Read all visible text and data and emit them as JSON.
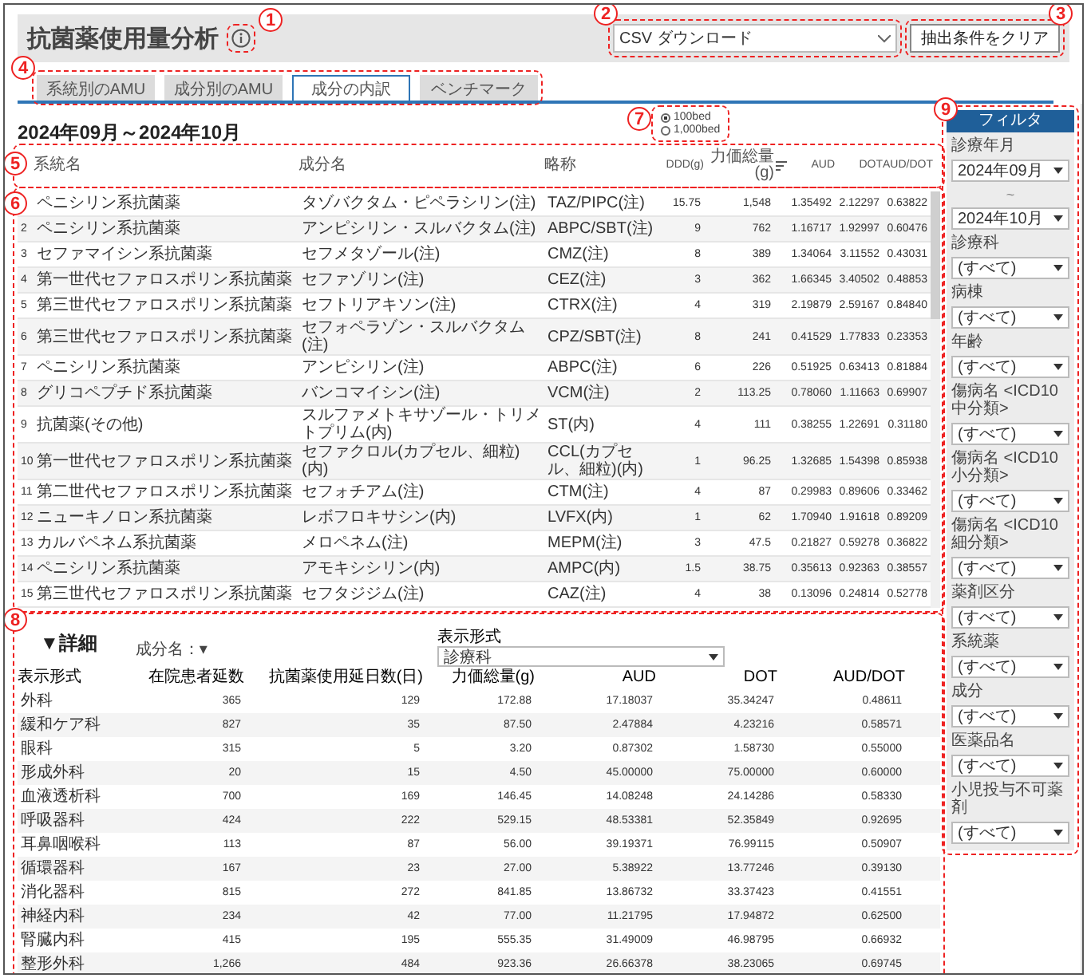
{
  "header": {
    "title": "抗菌薬使用量分析",
    "download": {
      "value": "CSV ダウンロード"
    },
    "clear_button": "抽出条件をクリア"
  },
  "tabs": [
    {
      "label": "系統別のAMU",
      "selected": false
    },
    {
      "label": "成分別のAMU",
      "selected": false
    },
    {
      "label": "成分の内訳",
      "selected": true
    },
    {
      "label": "ベンチマーク",
      "selected": false
    }
  ],
  "period": "2024年09月～2024年10月",
  "bed_options": [
    {
      "label": "100bed",
      "selected": true
    },
    {
      "label": "1,000bed",
      "selected": false
    }
  ],
  "table": {
    "columns": [
      "系統名",
      "成分名",
      "略称",
      "DDD(g)",
      "力価総量(g)",
      "AUD",
      "DOT",
      "AUD/DOT"
    ],
    "rows": [
      {
        "cells": [
          "ペニシリン系抗菌薬",
          "タゾバクタム・ピペラシリン(注)",
          "TAZ/PIPC(注)",
          "15.75",
          "1,548",
          "1.35492",
          "2.12297",
          "0.63822"
        ]
      },
      {
        "index": "2",
        "cells": [
          "ペニシリン系抗菌薬",
          "アンピシリン・スルバクタム(注)",
          "ABPC/SBT(注)",
          "9",
          "762",
          "1.16717",
          "1.92997",
          "0.60476"
        ]
      },
      {
        "index": "3",
        "cells": [
          "セファマイシン系抗菌薬",
          "セフメタゾール(注)",
          "CMZ(注)",
          "8",
          "389",
          "1.34064",
          "3.11552",
          "0.43031"
        ]
      },
      {
        "index": "4",
        "cells": [
          "第一世代セファロスポリン系抗菌薬",
          "セファゾリン(注)",
          "CEZ(注)",
          "3",
          "362",
          "1.66345",
          "3.40502",
          "0.48853"
        ]
      },
      {
        "index": "5",
        "cells": [
          "第三世代セファロスポリン系抗菌薬",
          "セフトリアキソン(注)",
          "CTRX(注)",
          "4",
          "319",
          "2.19879",
          "2.59167",
          "0.84840"
        ]
      },
      {
        "index": "6",
        "cells": [
          "第三世代セファロスポリン系抗菌薬",
          "セフォペラゾン・スルバクタム(注)",
          "CPZ/SBT(注)",
          "8",
          "241",
          "0.41529",
          "1.77833",
          "0.23353"
        ]
      },
      {
        "index": "7",
        "cells": [
          "ペニシリン系抗菌薬",
          "アンピシリン(注)",
          "ABPC(注)",
          "6",
          "226",
          "0.51925",
          "0.63413",
          "0.81884"
        ]
      },
      {
        "index": "8",
        "cells": [
          "グリコペプチド系抗菌薬",
          "バンコマイシン(注)",
          "VCM(注)",
          "2",
          "113.25",
          "0.78060",
          "1.11663",
          "0.69907"
        ]
      },
      {
        "index": "9",
        "cells": [
          "抗菌薬(その他)",
          "スルファメトキサゾール・トリメトプリム(内)",
          "ST(内)",
          "4",
          "111",
          "0.38255",
          "1.22691",
          "0.31180"
        ]
      },
      {
        "index": "10",
        "cells": [
          "第一世代セファロスポリン系抗菌薬",
          "セファクロル(カプセル、細粒)(内)",
          "CCL(カプセル、細粒)(内)",
          "1",
          "96.25",
          "1.32685",
          "1.54398",
          "0.85938"
        ]
      },
      {
        "index": "11",
        "cells": [
          "第二世代セファロスポリン系抗菌薬",
          "セフォチアム(注)",
          "CTM(注)",
          "4",
          "87",
          "0.29983",
          "0.89606",
          "0.33462"
        ]
      },
      {
        "index": "12",
        "cells": [
          "ニューキノロン系抗菌薬",
          "レボフロキサシン(内)",
          "LVFX(内)",
          "1",
          "62",
          "1.70940",
          "1.91618",
          "0.89209"
        ]
      },
      {
        "index": "13",
        "cells": [
          "カルバペネム系抗菌薬",
          "メロペネム(注)",
          "MEPM(注)",
          "3",
          "47.5",
          "0.21827",
          "0.59278",
          "0.36822"
        ]
      },
      {
        "index": "14",
        "cells": [
          "ペニシリン系抗菌薬",
          "アモキシシリン(内)",
          "AMPC(内)",
          "1.5",
          "38.75",
          "0.35613",
          "0.92363",
          "0.38557"
        ]
      },
      {
        "index": "15",
        "cells": [
          "第三世代セファロスポリン系抗菌薬",
          "セフタジジム(注)",
          "CAZ(注)",
          "4",
          "38",
          "0.13096",
          "0.24814",
          "0.52778"
        ]
      }
    ]
  },
  "detail": {
    "title": "▼詳細",
    "component_filter": "成分名：▾",
    "display_label": "表示形式",
    "display_value": "診療科",
    "columns": [
      "表示形式",
      "在院患者延数",
      "抗菌薬使用延日数(日)",
      "力価総量(g)",
      "AUD",
      "DOT",
      "AUD/DOT"
    ],
    "rows": [
      [
        "外科",
        "365",
        "129",
        "172.88",
        "17.18037",
        "35.34247",
        "0.48611"
      ],
      [
        "緩和ケア科",
        "827",
        "35",
        "87.50",
        "2.47884",
        "4.23216",
        "0.58571"
      ],
      [
        "眼科",
        "315",
        "5",
        "3.20",
        "0.87302",
        "1.58730",
        "0.55000"
      ],
      [
        "形成外科",
        "20",
        "15",
        "4.50",
        "45.00000",
        "75.00000",
        "0.60000"
      ],
      [
        "血液透析科",
        "700",
        "169",
        "146.45",
        "14.08248",
        "24.14286",
        "0.58330"
      ],
      [
        "呼吸器科",
        "424",
        "222",
        "529.15",
        "48.53381",
        "52.35849",
        "0.92695"
      ],
      [
        "耳鼻咽喉科",
        "113",
        "87",
        "56.00",
        "39.19371",
        "76.99115",
        "0.50907"
      ],
      [
        "循環器科",
        "167",
        "23",
        "27.00",
        "5.38922",
        "13.77246",
        "0.39130"
      ],
      [
        "消化器科",
        "815",
        "272",
        "841.85",
        "13.86732",
        "33.37423",
        "0.41551"
      ],
      [
        "神経内科",
        "234",
        "42",
        "77.00",
        "11.21795",
        "17.94872",
        "0.62500"
      ],
      [
        "腎臓内科",
        "415",
        "195",
        "555.35",
        "31.49009",
        "46.98795",
        "0.66932"
      ],
      [
        "整形外科",
        "1,266",
        "484",
        "923.36",
        "26.66378",
        "38.23065",
        "0.69745"
      ]
    ]
  },
  "filter": {
    "title": "フィルタ",
    "fields": [
      {
        "label": "診療年月",
        "value": "2024年09月"
      },
      {
        "separator": "~",
        "value": "2024年10月"
      },
      {
        "label": "診療科",
        "value": "(すべて)"
      },
      {
        "label": "病棟",
        "value": "(すべて)"
      },
      {
        "label": "年齢",
        "value": "(すべて)"
      },
      {
        "label": "傷病名 <ICD10 中分類>",
        "value": "(すべて)"
      },
      {
        "label": "傷病名 <ICD10 小分類>",
        "value": "(すべて)"
      },
      {
        "label": "傷病名 <ICD10 細分類>",
        "value": "(すべて)"
      },
      {
        "label": "薬剤区分",
        "value": "(すべて)"
      },
      {
        "label": "系統薬",
        "value": "(すべて)"
      },
      {
        "label": "成分",
        "value": "(すべて)"
      },
      {
        "label": "医薬品名",
        "value": "(すべて)"
      },
      {
        "label": "小児投与不可薬剤",
        "value": "(すべて)"
      }
    ]
  },
  "annotations": [
    "1",
    "2",
    "3",
    "4",
    "5",
    "6",
    "7",
    "8",
    "9"
  ]
}
